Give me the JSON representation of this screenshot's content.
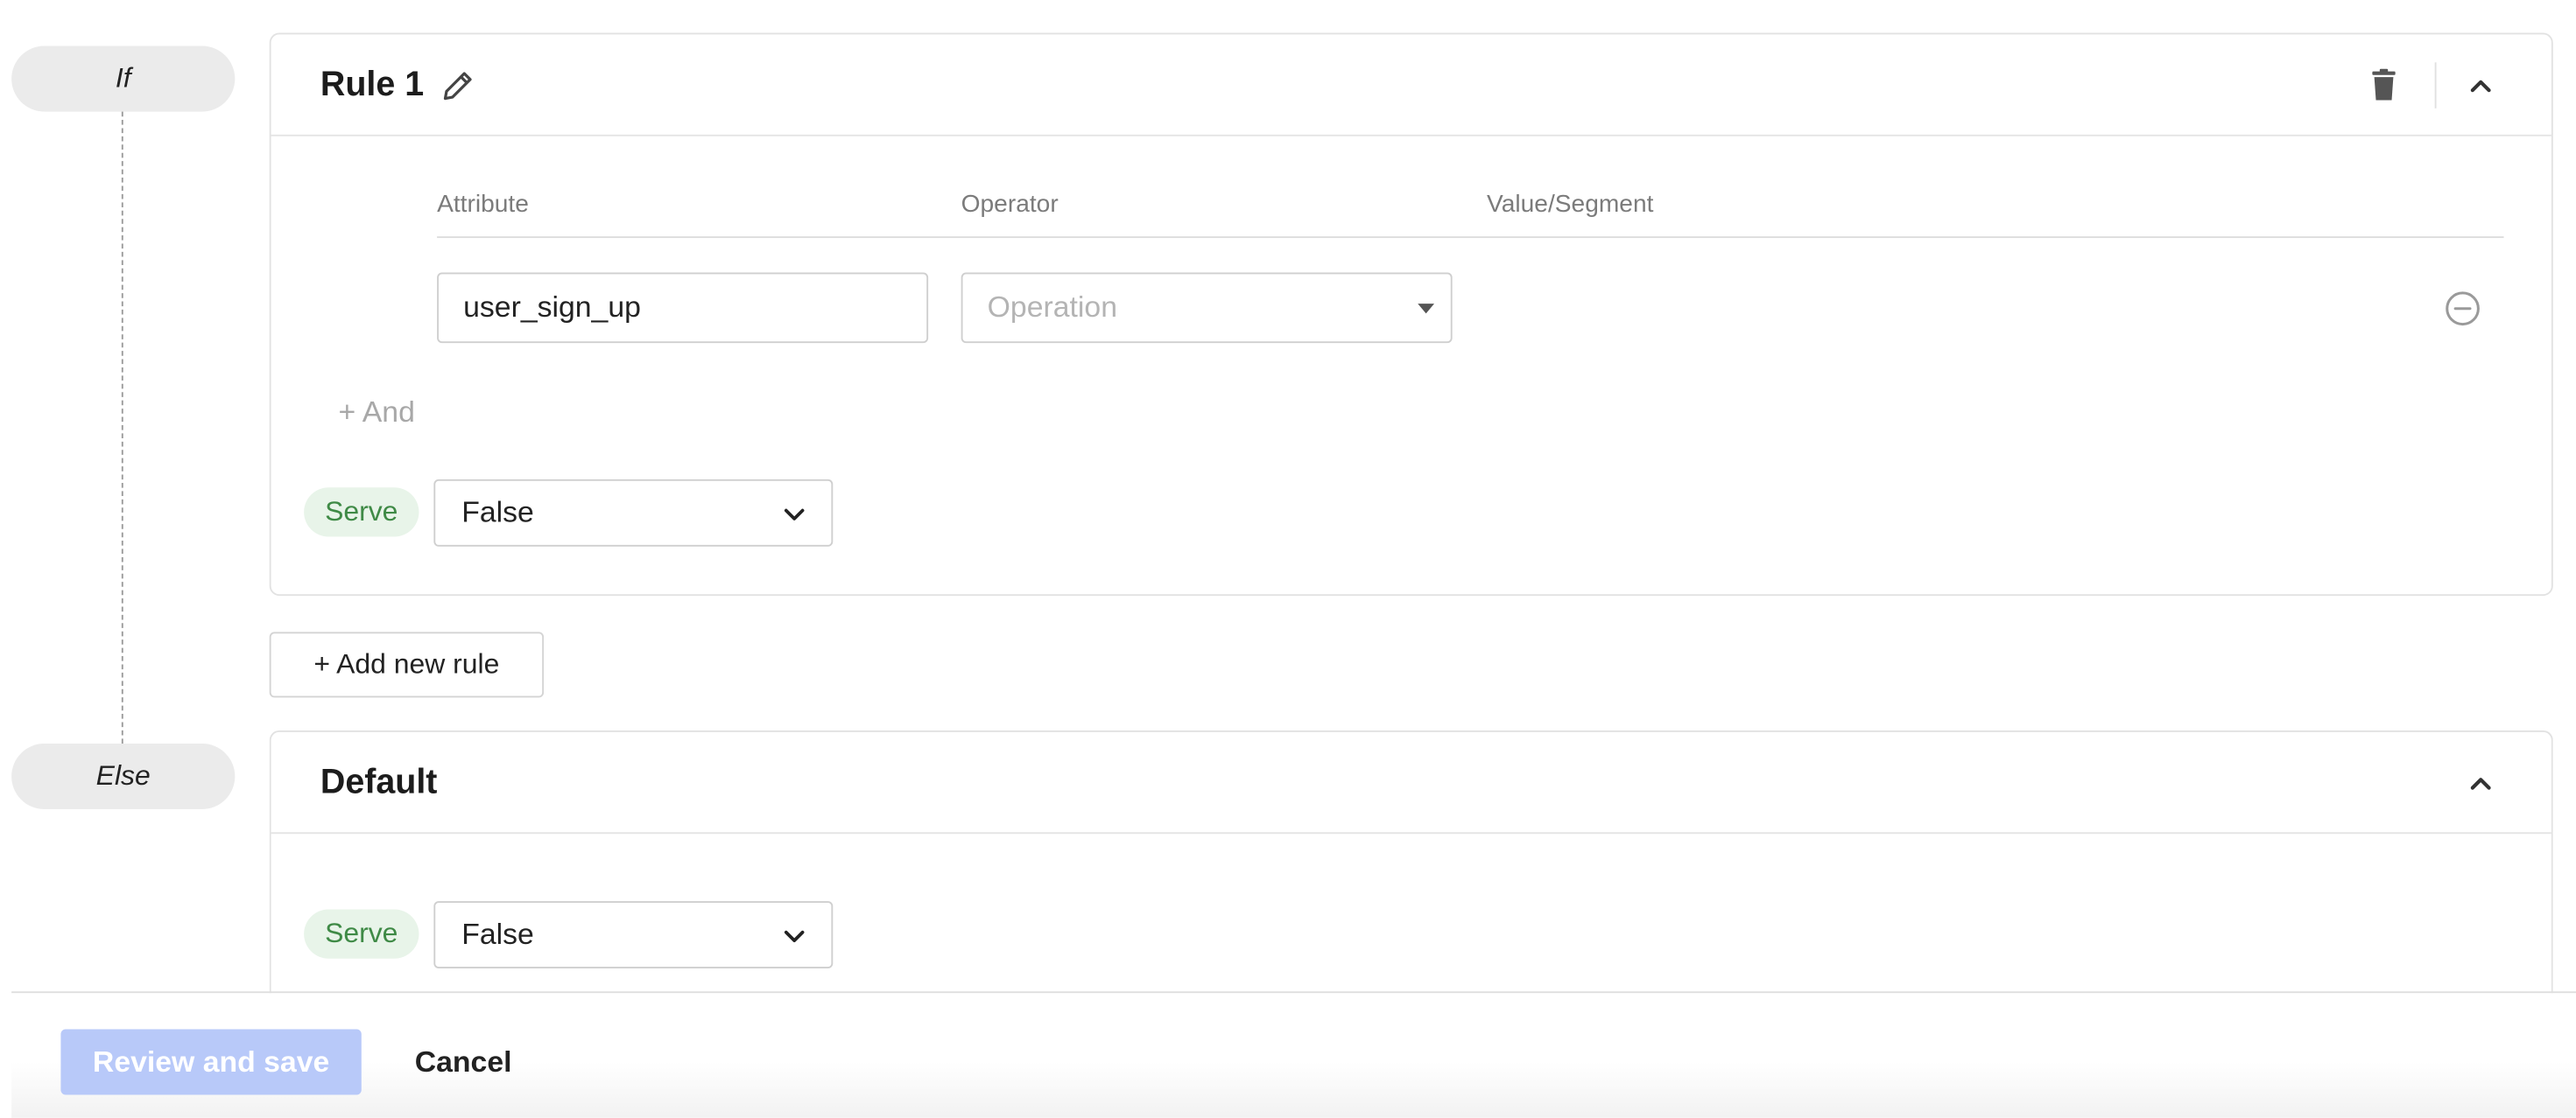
{
  "flow": {
    "if_label": "If",
    "else_label": "Else"
  },
  "rule": {
    "title": "Rule 1",
    "columns": {
      "attribute": "Attribute",
      "operator": "Operator",
      "value": "Value/Segment"
    },
    "condition": {
      "attribute_value": "user_sign_up",
      "operator_placeholder": "Operation"
    },
    "and_label": "+ And",
    "serve_label": "Serve",
    "serve_value": "False"
  },
  "add_rule_label": "+ Add new rule",
  "default": {
    "title": "Default",
    "serve_label": "Serve",
    "serve_value": "False"
  },
  "footer": {
    "review_label": "Review and save",
    "cancel_label": "Cancel"
  },
  "icons": {
    "edit": "pencil-icon",
    "delete": "trash-icon",
    "collapse": "chevron-up-icon",
    "remove_condition": "minus-circle-icon",
    "dropdown": "chevron-down-icon"
  },
  "colors": {
    "serve_badge_bg": "#e8f4e9",
    "serve_badge_text": "#3f8a46",
    "primary_disabled": "#b8c9f9",
    "pill_bg": "#ebebeb"
  }
}
